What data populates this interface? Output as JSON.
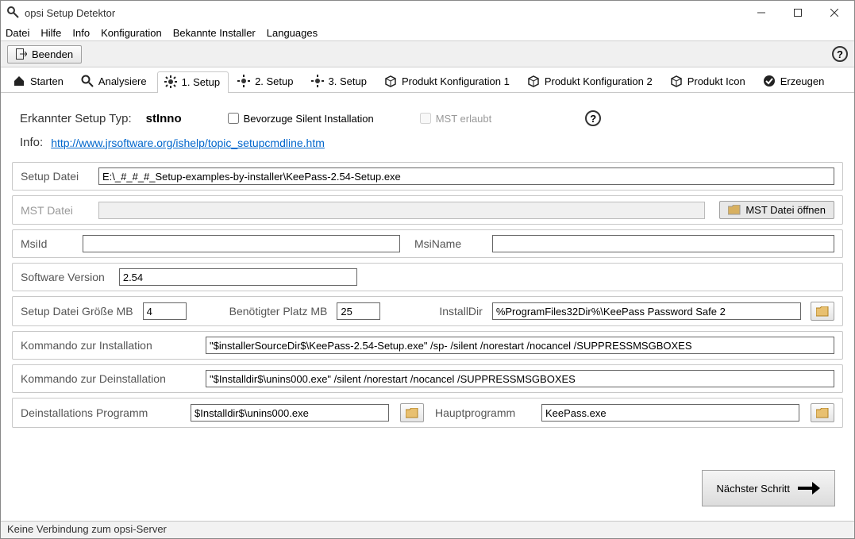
{
  "window": {
    "title": "opsi Setup Detektor"
  },
  "menu": {
    "file": "Datei",
    "help": "Hilfe",
    "info": "Info",
    "config": "Konfiguration",
    "installers": "Bekannte Installer",
    "languages": "Languages"
  },
  "toolbar": {
    "quit": "Beenden"
  },
  "tabs": {
    "start": "Starten",
    "analyse": "Analysiere",
    "setup1": "1. Setup",
    "setup2": "2. Setup",
    "setup3": "3. Setup",
    "prodconf1": "Produkt Konfiguration 1",
    "prodconf2": "Produkt Konfiguration 2",
    "prodicon": "Produkt Icon",
    "create": "Erzeugen"
  },
  "header": {
    "detectedTypeLabel": "Erkannter Setup Typ:",
    "detectedType": "stInno",
    "preferSilent": "Bevorzuge Silent Installation",
    "mstAllowed": "MST erlaubt",
    "infoLabel": "Info:",
    "infoLink": "http://www.jrsoftware.org/ishelp/topic_setupcmdline.htm"
  },
  "fields": {
    "setupFileLabel": "Setup Datei",
    "setupFile": "E:\\_#_#_#_Setup-examples-by-installer\\KeePass-2.54-Setup.exe",
    "mstFileLabel": "MST Datei",
    "mstFile": "",
    "mstOpenBtn": "MST Datei öffnen",
    "msiIdLabel": "MsiId",
    "msiId": "",
    "msiNameLabel": "MsiName",
    "msiName": "",
    "versionLabel": "Software Version",
    "version": "2.54",
    "sizeLabel": "Setup Datei Größe MB",
    "size": "4",
    "requiredLabel": "Benötigter Platz MB",
    "required": "25",
    "installDirLabel": "InstallDir",
    "installDir": "%ProgramFiles32Dir%\\KeePass Password Safe 2",
    "installCmdLabel": "Kommando zur Installation",
    "installCmd": "\"$installerSourceDir$\\KeePass-2.54-Setup.exe\" /sp- /silent /norestart /nocancel /SUPPRESSMSGBOXES",
    "uninstallCmdLabel": "Kommando zur Deinstallation",
    "uninstallCmd": "\"$Installdir$\\unins000.exe\" /silent /norestart /nocancel /SUPPRESSMSGBOXES",
    "uninstallProgLabel": "Deinstallations Programm",
    "uninstallProg": "$Installdir$\\unins000.exe",
    "mainProgLabel": "Hauptprogramm",
    "mainProg": "KeePass.exe"
  },
  "footer": {
    "next": "Nächster Schritt"
  },
  "status": {
    "text": "Keine Verbindung zum opsi-Server"
  }
}
